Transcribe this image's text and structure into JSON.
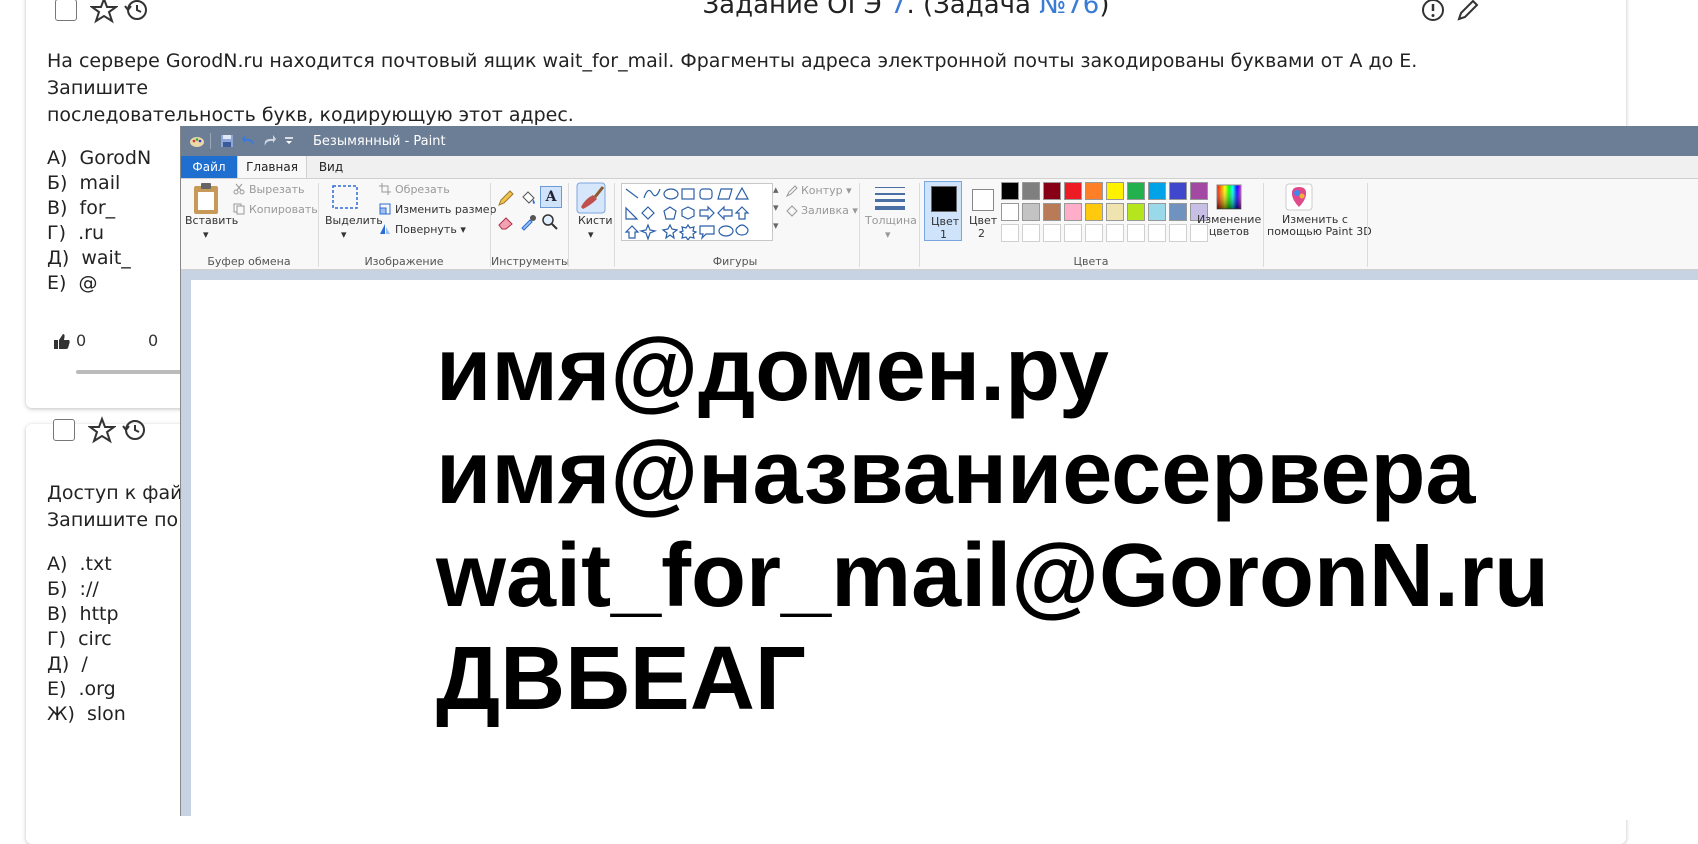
{
  "task1": {
    "title_prefix": "Задание ОГЭ ",
    "title_num": "7",
    "title_mid": ". (Задача ",
    "title_task": "№76",
    "title_end": ")",
    "text_line1": "На сервере GorodN.ru находится почтовый ящик wait_for_mail. Фрагменты адреса электронной почты закодированы буквами от А до Е. Запишите",
    "text_line2": "последовательность букв, кодирующую этот адрес.",
    "options": [
      {
        "letter": "А)",
        "value": "GorodN"
      },
      {
        "letter": "Б)",
        "value": "mail"
      },
      {
        "letter": "В)",
        "value": "for_"
      },
      {
        "letter": "Г)",
        "value": ".ru"
      },
      {
        "letter": "Д)",
        "value": "wait_"
      },
      {
        "letter": "Е)",
        "value": "@"
      }
    ],
    "likes": "0",
    "dislikes": "0"
  },
  "task2": {
    "text_line1": "Доступ к фай",
    "text_line2": "Запишите по",
    "options": [
      {
        "letter": "А)",
        "value": ".txt"
      },
      {
        "letter": "Б)",
        "value": "://"
      },
      {
        "letter": "В)",
        "value": "http"
      },
      {
        "letter": "Г)",
        "value": "circ"
      },
      {
        "letter": "Д)",
        "value": "/"
      },
      {
        "letter": "Е)",
        "value": ".org"
      },
      {
        "letter": "Ж)",
        "value": "slon"
      }
    ]
  },
  "paint": {
    "window_title": "Безымянный - Paint",
    "tabs": {
      "file": "Файл",
      "home": "Главная",
      "view": "Вид"
    },
    "clipboard": {
      "paste": "Вставить",
      "cut": "Вырезать",
      "copy": "Копировать",
      "label": "Буфер обмена"
    },
    "image": {
      "select": "Выделить",
      "crop": "Обрезать",
      "resize": "Изменить размер",
      "rotate": "Повернуть",
      "label": "Изображение"
    },
    "tools": {
      "label": "Инструменты"
    },
    "brushes": {
      "label": "Кисти"
    },
    "shapes": {
      "outline": "Контур",
      "fill": "Заливка",
      "label": "Фигуры"
    },
    "size": {
      "label": "Толщина"
    },
    "color1": {
      "label": "Цвет",
      "num": "1"
    },
    "color2": {
      "label": "Цвет",
      "num": "2"
    },
    "edit_colors": {
      "line1": "Изменение",
      "line2": "цветов"
    },
    "paint3d": {
      "line1": "Изменить с",
      "line2": "помощью Paint 3D"
    },
    "colors_label": "Цвета",
    "palette_row1": [
      "#000000",
      "#7f7f7f",
      "#880015",
      "#ed1c24",
      "#ff7f27",
      "#fff200",
      "#22b14c",
      "#00a2e8",
      "#3f48cc",
      "#a349a4"
    ],
    "palette_row2": [
      "#ffffff",
      "#c3c3c3",
      "#b97a57",
      "#ffaec9",
      "#ffc90e",
      "#efe4b0",
      "#b5e61d",
      "#99d9ea",
      "#7092be",
      "#c8bfe7"
    ],
    "canvas_lines": [
      "имя@домен.ру",
      "имя@названиесервера",
      "wait_for_mail@GoronN.ru",
      "ДВБЕАГ"
    ]
  }
}
